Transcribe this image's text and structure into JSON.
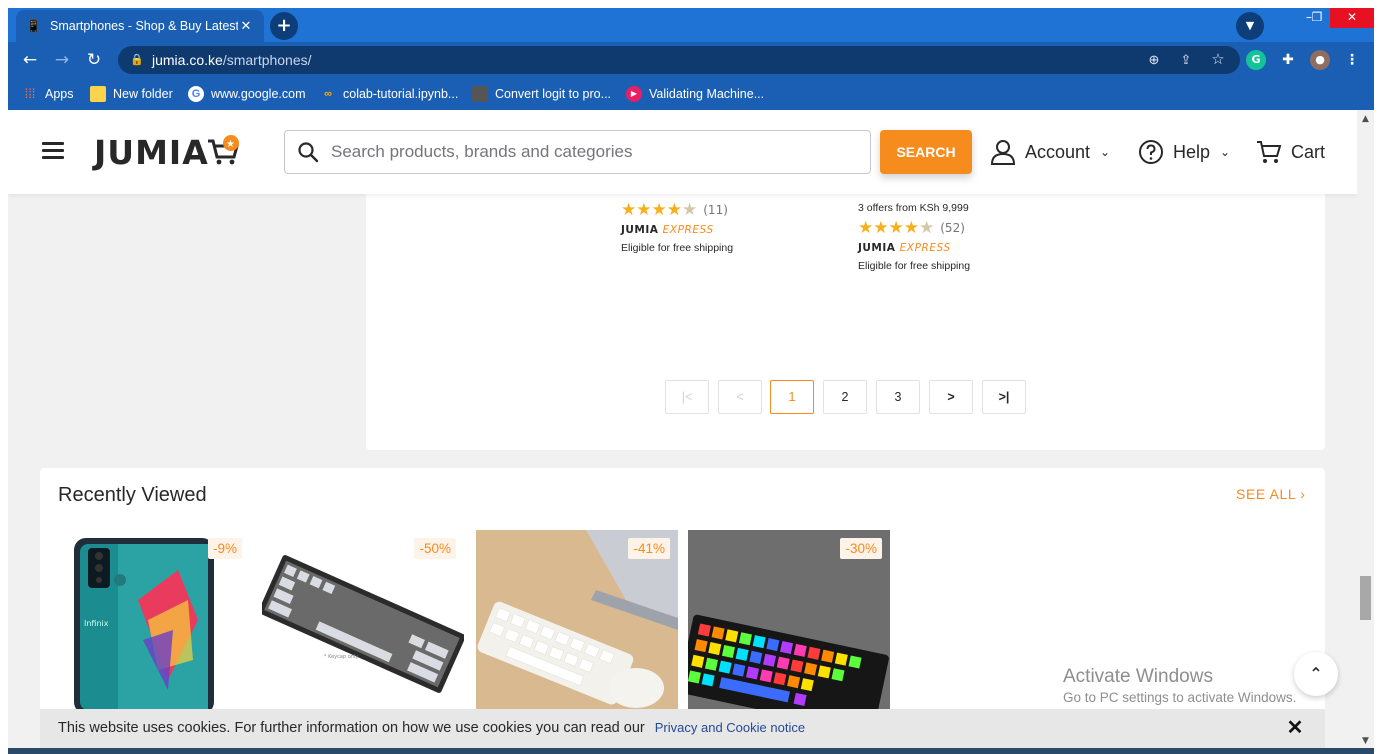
{
  "browser": {
    "tab_title": "Smartphones - Shop & Buy Latest Smartphones",
    "tab_close": "✕",
    "new_tab": "+",
    "url_domain": "jumia.co.ke",
    "url_path": "/smartphones/",
    "bookmarks": [
      {
        "label": "Apps",
        "icon": "apps-grid-icon"
      },
      {
        "label": "New folder",
        "icon": "folder-icon"
      },
      {
        "label": "www.google.com",
        "icon": "google-icon"
      },
      {
        "label": "colab-tutorial.ipynb...",
        "icon": "colab-icon"
      },
      {
        "label": "Convert logit to pro...",
        "icon": "page-icon"
      },
      {
        "label": "Validating Machine...",
        "icon": "play-icon"
      }
    ],
    "extensions": {
      "grammarly": "G"
    }
  },
  "header": {
    "logo": "JUMIA",
    "search_placeholder": "Search products, brands and categories",
    "search_button": "SEARCH",
    "account_label": "Account",
    "help_label": "Help",
    "cart_label": "Cart"
  },
  "results": {
    "product_a": {
      "rating": 4.5,
      "reviews": "(11)",
      "express_brand": "JUMIA",
      "express_label": "EXPRESS",
      "shipping": "Eligible for free shipping"
    },
    "product_b": {
      "offers": "3 offers from KSh 9,999",
      "rating": 4.5,
      "reviews": "(52)",
      "express_brand": "JUMIA",
      "express_label": "EXPRESS",
      "shipping": "Eligible for free shipping"
    },
    "pagination": {
      "first": "|<",
      "prev": "<",
      "pages": [
        "1",
        "2",
        "3"
      ],
      "active": "1",
      "next": ">",
      "last": ">|"
    }
  },
  "recently_viewed": {
    "title": "Recently Viewed",
    "see_all": "SEE ALL",
    "items": [
      {
        "discount": "-9%",
        "kind": "smartphone"
      },
      {
        "discount": "-50%",
        "kind": "grey-keyboard"
      },
      {
        "discount": "-41%",
        "kind": "white-keyboard-mouse"
      },
      {
        "discount": "-30%",
        "kind": "rgb-keyboard"
      }
    ]
  },
  "cookie": {
    "text": "This website uses cookies. For further information on how we use cookies you can read our",
    "link": "Privacy and Cookie notice",
    "close": "✕"
  },
  "watermark": {
    "line1": "Activate Windows",
    "line2": "Go to PC settings to activate Windows."
  },
  "colors": {
    "accent": "#f68b1e",
    "chrome_blue": "#1a5fb4",
    "star": "#f6b01e"
  }
}
